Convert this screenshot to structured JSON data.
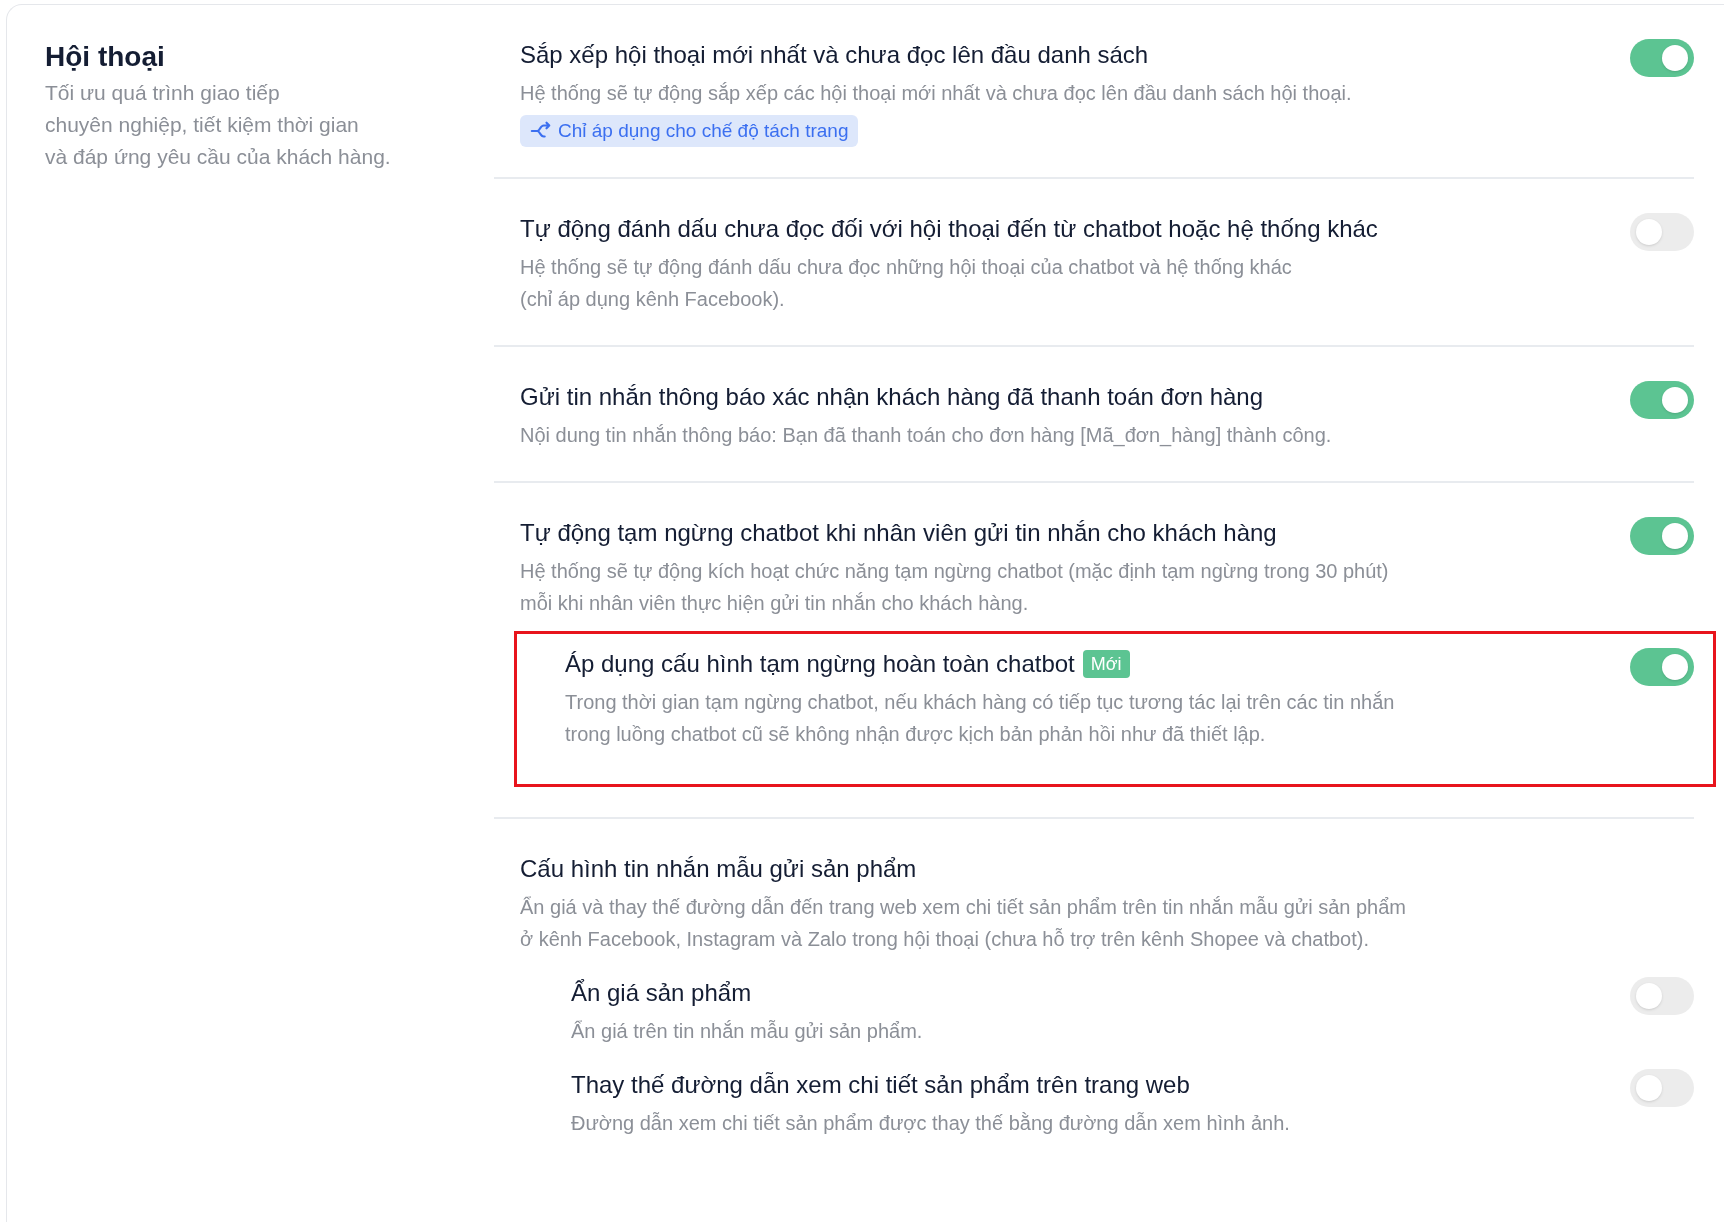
{
  "section": {
    "title": "Hội thoại",
    "description_lines": [
      "Tối ưu quá trình giao tiếp",
      "chuyên nghiệp, tiết kiệm thời gian",
      "và đáp ứng yêu cầu của khách hàng."
    ]
  },
  "settings": [
    {
      "title": "Sắp xếp hội thoại mới nhất và chưa đọc lên đầu danh sách",
      "description_lines": [
        "Hệ thống sẽ tự động sắp xếp các hội thoại mới nhất và chưa đọc lên đầu danh sách hội thoại."
      ],
      "tag": "Chỉ áp dụng cho chế độ tách trang",
      "on": true
    },
    {
      "title": "Tự động đánh dấu chưa đọc đối với hội thoại đến từ chatbot hoặc hệ thống khác",
      "description_lines": [
        "Hệ thống sẽ tự động đánh dấu chưa đọc những hội thoại của chatbot và hệ thống khác",
        "(chỉ áp dụng kênh Facebook)."
      ],
      "on": false
    },
    {
      "title": "Gửi tin nhắn thông báo xác nhận khách hàng đã thanh toán đơn hàng",
      "description_lines": [
        "Nội dung tin nhắn thông báo: Bạn đã thanh toán cho đơn hàng [Mã_đơn_hàng] thành công."
      ],
      "on": true
    },
    {
      "title": "Tự động tạm ngừng chatbot khi nhân viên gửi tin nhắn cho khách hàng",
      "description_lines": [
        "Hệ thống sẽ tự động kích hoạt chức năng tạm ngừng chatbot (mặc định tạm ngừng trong 30 phút)",
        "mỗi khi nhân viên thực hiện gửi tin nhắn cho khách hàng."
      ],
      "on": true,
      "children": [
        {
          "title": "Áp dụng cấu hình tạm ngừng hoàn toàn chatbot",
          "badge": "Mới",
          "description_lines": [
            "Trong thời gian tạm ngừng chatbot, nếu khách hàng có tiếp tục tương tác lại trên các tin nhắn",
            "trong luồng chatbot cũ sẽ không nhận được kịch bản phản hồi như đã thiết lập."
          ],
          "on": true,
          "highlighted": true
        }
      ]
    },
    {
      "title": "Cấu hình tin nhắn mẫu gửi sản phẩm",
      "description_lines": [
        "Ẩn giá và thay thế đường dẫn đến trang web xem chi tiết sản phẩm trên tin nhắn mẫu gửi sản phẩm",
        "ở kênh Facebook, Instagram và Zalo trong hội thoại (chưa hỗ trợ trên kênh Shopee và chatbot)."
      ],
      "children": [
        {
          "title": "Ẩn giá sản phẩm",
          "description_lines": [
            "Ẩn giá trên tin nhắn mẫu gửi sản phẩm."
          ],
          "on": false,
          "highlighted": false
        },
        {
          "title": "Thay thế đường dẫn xem chi tiết sản phẩm trên trang web",
          "description_lines": [
            "Đường dẫn xem chi tiết sản phẩm được thay thế bằng đường dẫn xem hình ảnh."
          ],
          "on": false,
          "highlighted": false
        }
      ]
    }
  ]
}
